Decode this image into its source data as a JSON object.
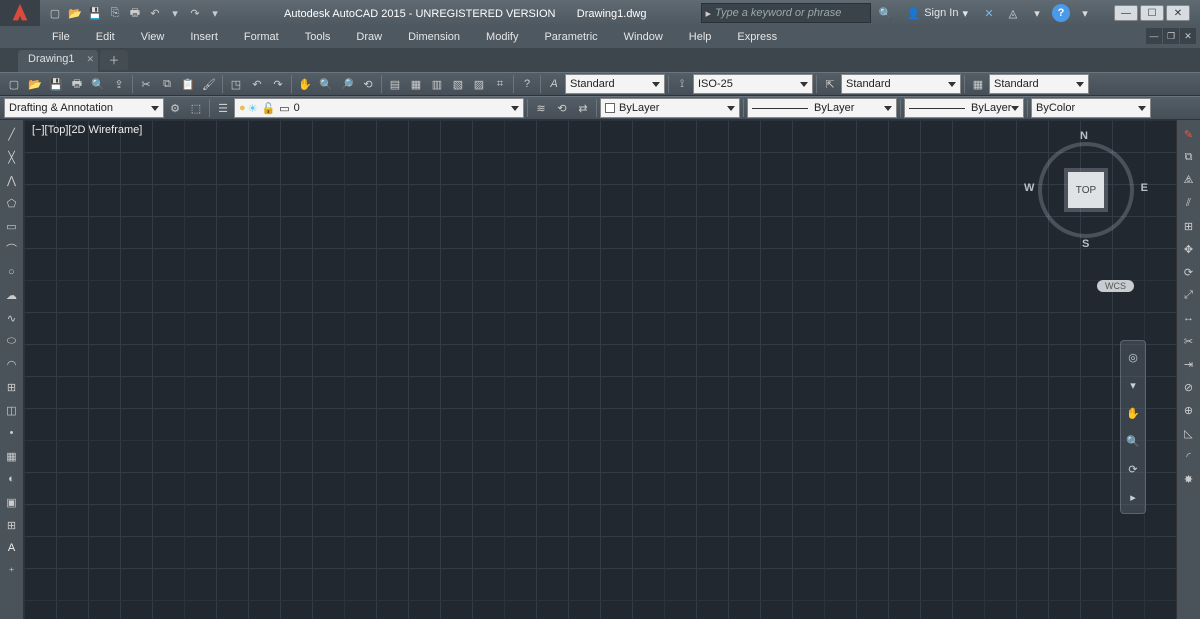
{
  "title": {
    "app": "Autodesk AutoCAD 2015 - UNREGISTERED VERSION",
    "file": "Drawing1.dwg"
  },
  "search_placeholder": "Type a keyword or phrase",
  "signin": "Sign In",
  "menus": [
    "File",
    "Edit",
    "View",
    "Insert",
    "Format",
    "Tools",
    "Draw",
    "Dimension",
    "Modify",
    "Parametric",
    "Window",
    "Help",
    "Express"
  ],
  "filetab": "Drawing1",
  "row1": {
    "text_style": "Standard",
    "dim_style": "ISO-25",
    "ml_style": "Standard",
    "tbl_style": "Standard"
  },
  "row2": {
    "workspace": "Drafting & Annotation",
    "layer": "0",
    "layer_combo": "ByLayer",
    "linetype": "ByLayer",
    "lineweight": "ByLayer",
    "plotstyle": "ByColor"
  },
  "view_label": "[−][Top][2D Wireframe]",
  "viewcube": {
    "face": "TOP",
    "n": "N",
    "s": "S",
    "e": "E",
    "w": "W",
    "wcs": "WCS"
  }
}
